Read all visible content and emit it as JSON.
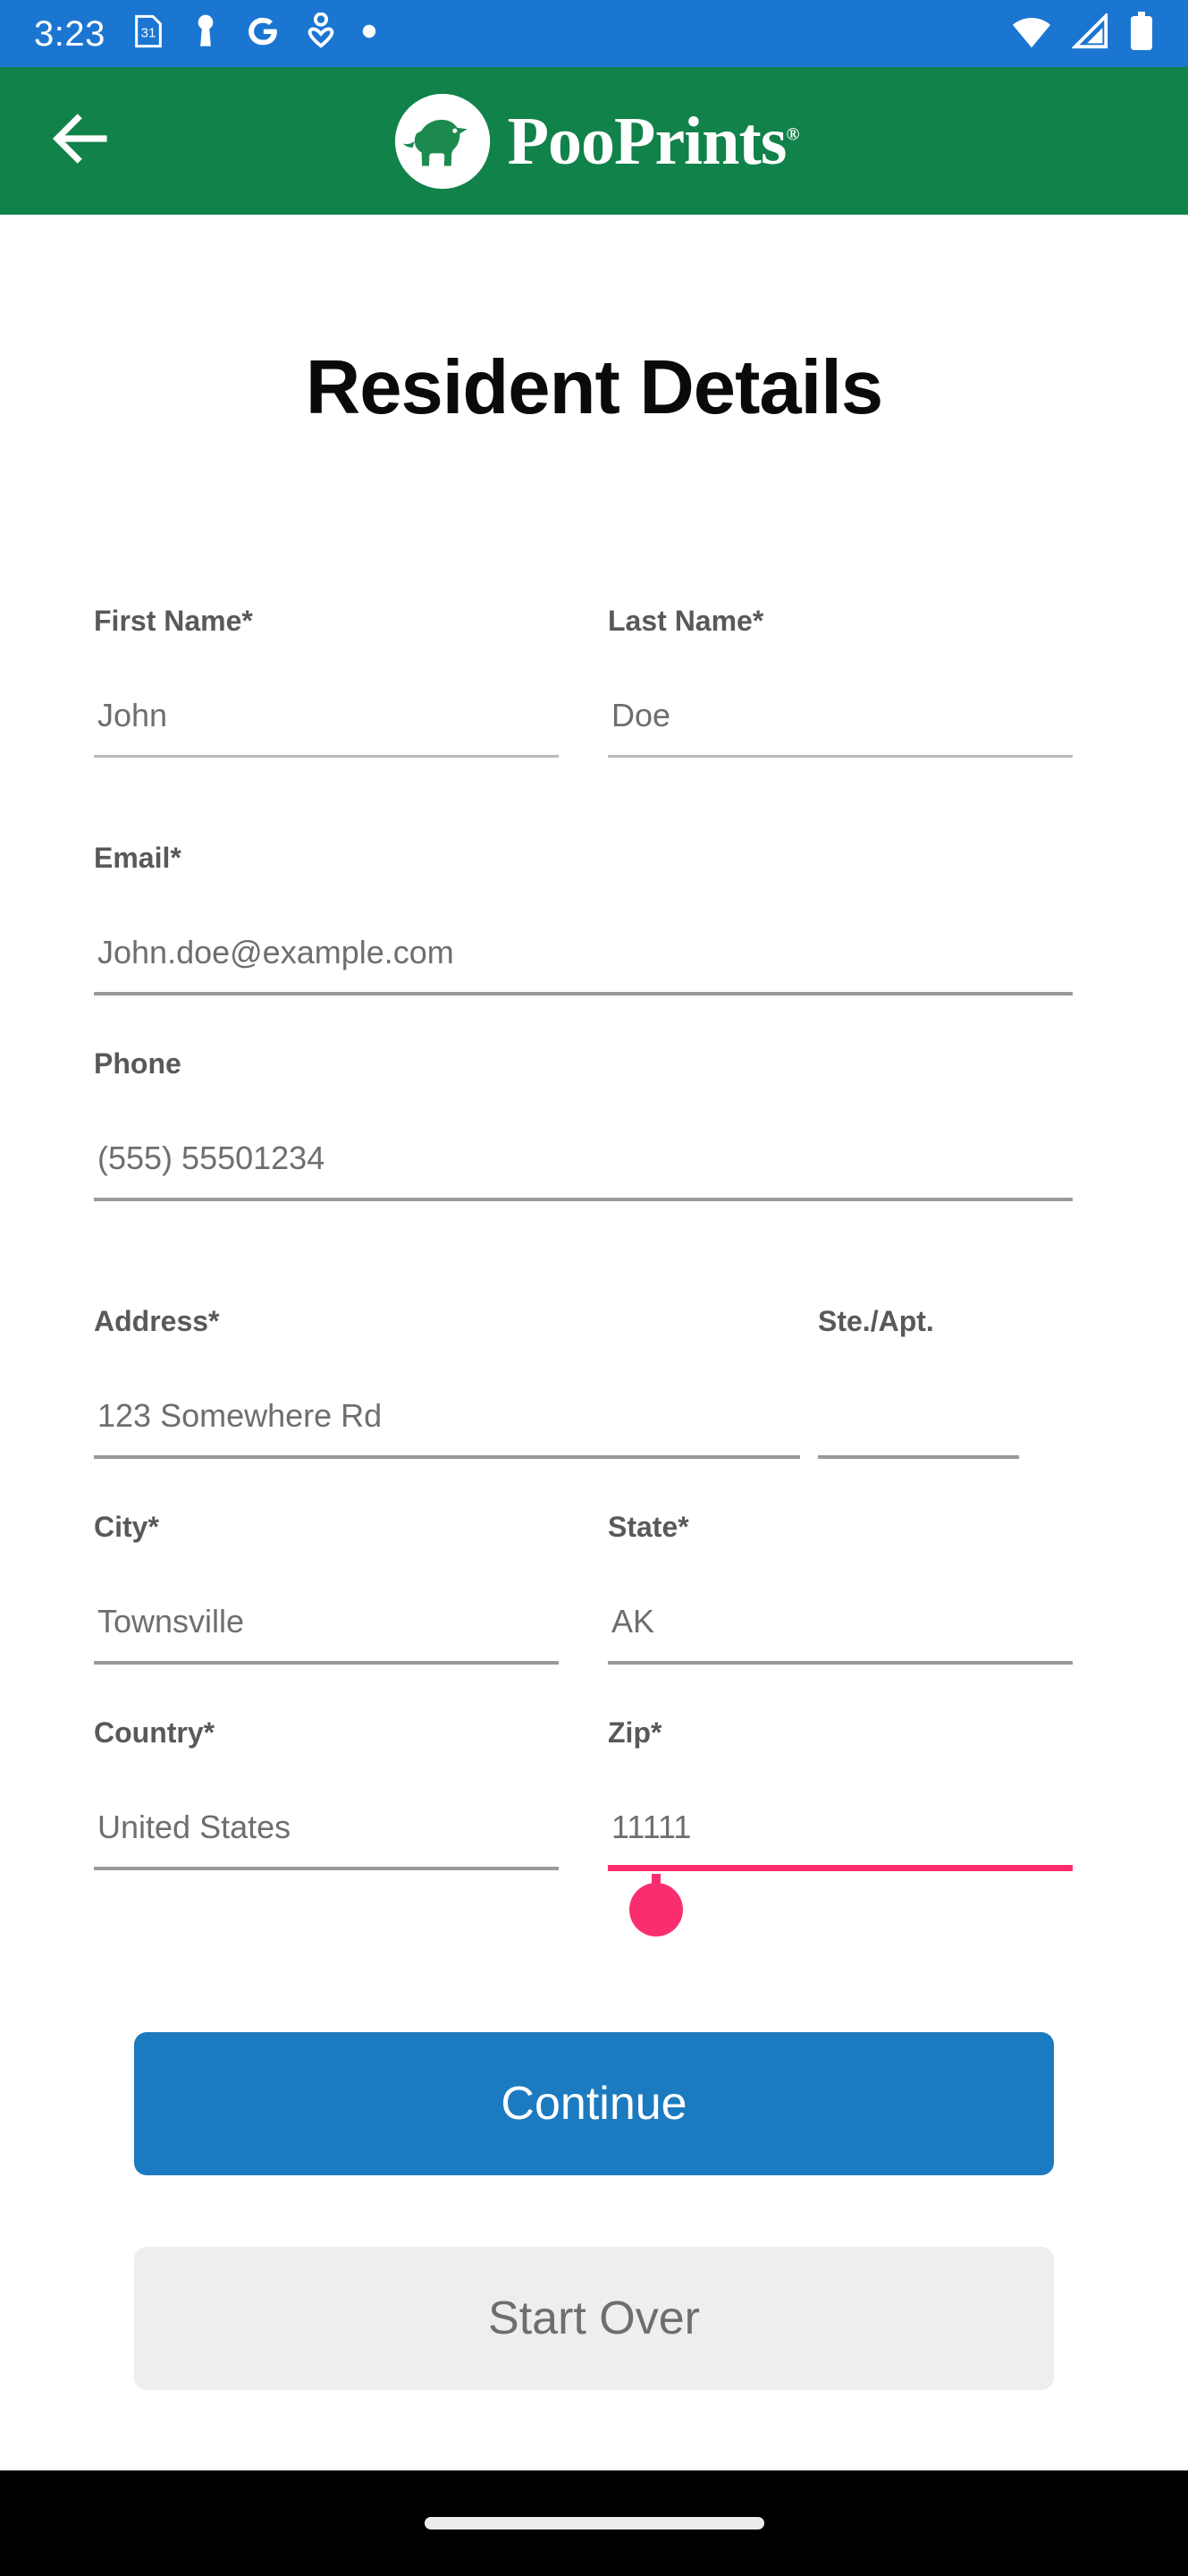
{
  "status_bar": {
    "time": "3:23",
    "left_icons": [
      "calendar-31-icon",
      "keyhole-pin-icon",
      "google-g-icon",
      "heart-person-icon",
      "dot-icon"
    ],
    "right_icons": [
      "wifi-icon",
      "cellular-signal-icon",
      "battery-icon"
    ],
    "background_color": "#1b76d2"
  },
  "app_bar": {
    "back_label": "Back",
    "logo_text": "PooPrints",
    "logo_trademark": "®",
    "background_color": "#10824a"
  },
  "page": {
    "title": "Resident Details"
  },
  "form": {
    "fields": [
      {
        "label": "First Name*",
        "value": "John"
      },
      {
        "label": "Last Name*",
        "value": "Doe"
      },
      {
        "label": "Email*",
        "value": "John.doe@example.com"
      },
      {
        "label": "Phone",
        "value": "(555) 55501234"
      },
      {
        "label": "Address*",
        "value": "123 Somewhere Rd"
      },
      {
        "label": "Ste./Apt.",
        "value": ""
      },
      {
        "label": "City*",
        "value": "Townsville"
      },
      {
        "label": "State*",
        "value": "AK"
      },
      {
        "label": "Country*",
        "value": "United States"
      },
      {
        "label": "Zip*",
        "value": "11111"
      }
    ],
    "active_field_label": "Zip*",
    "active_underline_color": "#fa2e6e"
  },
  "actions": {
    "continue_label": "Continue",
    "continue_color": "#1c7bc0",
    "start_over_label": "Start Over",
    "start_over_color": "#eeeeee"
  },
  "nav_bar": {
    "handle": "gesture-pill"
  }
}
